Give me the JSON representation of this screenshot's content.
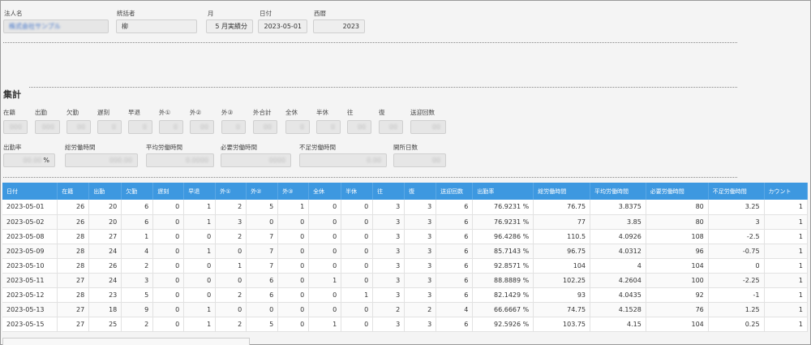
{
  "header": {
    "fields": [
      {
        "label": "法人名",
        "value": "株式会社サンプル",
        "blurred": true
      },
      {
        "label": "統括者",
        "value": "柳"
      },
      {
        "label": "月",
        "value": "5 月実績分"
      },
      {
        "label": "日付",
        "value": "2023-05-01"
      },
      {
        "label": "西暦",
        "value": "2023"
      }
    ]
  },
  "summary": {
    "title": "集計",
    "row1": [
      {
        "label": "在籍",
        "value": "000"
      },
      {
        "label": "出勤",
        "value": "000"
      },
      {
        "label": "欠勤",
        "value": "00"
      },
      {
        "label": "遅刻",
        "value": "0"
      },
      {
        "label": "早退",
        "value": "0"
      },
      {
        "label": "外①",
        "value": "0"
      },
      {
        "label": "外②",
        "value": "00"
      },
      {
        "label": "外③",
        "value": "0"
      },
      {
        "label": "外合計",
        "value": "00"
      },
      {
        "label": "全休",
        "value": "0"
      },
      {
        "label": "半休",
        "value": "0"
      },
      {
        "label": "往",
        "value": "00"
      },
      {
        "label": "復",
        "value": "00"
      },
      {
        "label": "送迎回数",
        "value": "00"
      }
    ],
    "row2": [
      {
        "label": "出勤率",
        "value": "00.00",
        "suffix": "%"
      },
      {
        "label": "総労働時間",
        "value": "000.00"
      },
      {
        "label": "平均労働時間",
        "value": "0.0000"
      },
      {
        "label": "必要労働時間",
        "value": "0000"
      },
      {
        "label": "不足労働時間",
        "value": "0.00"
      },
      {
        "label": "開所日数",
        "value": "00"
      }
    ]
  },
  "table": {
    "headers": [
      "日付",
      "在籍",
      "出勤",
      "欠勤",
      "遅刻",
      "早退",
      "外①",
      "外②",
      "外③",
      "全休",
      "半休",
      "往",
      "復",
      "送迎回数",
      "出勤率",
      "総労働時間",
      "平均労働時間",
      "必要労働時間",
      "不足労働時間",
      "カウント"
    ],
    "rows": [
      [
        "2023-05-01",
        "26",
        "20",
        "6",
        "0",
        "1",
        "2",
        "5",
        "1",
        "0",
        "0",
        "3",
        "3",
        "6",
        "76.9231 %",
        "76.75",
        "3.8375",
        "80",
        "3.25",
        "1"
      ],
      [
        "2023-05-02",
        "26",
        "20",
        "6",
        "0",
        "1",
        "3",
        "0",
        "0",
        "0",
        "0",
        "3",
        "3",
        "6",
        "76.9231 %",
        "77",
        "3.85",
        "80",
        "3",
        "1"
      ],
      [
        "2023-05-08",
        "28",
        "27",
        "1",
        "0",
        "0",
        "2",
        "7",
        "0",
        "0",
        "0",
        "3",
        "3",
        "6",
        "96.4286 %",
        "110.5",
        "4.0926",
        "108",
        "-2.5",
        "1"
      ],
      [
        "2023-05-09",
        "28",
        "24",
        "4",
        "0",
        "1",
        "0",
        "7",
        "0",
        "0",
        "0",
        "3",
        "3",
        "6",
        "85.7143 %",
        "96.75",
        "4.0312",
        "96",
        "-0.75",
        "1"
      ],
      [
        "2023-05-10",
        "28",
        "26",
        "2",
        "0",
        "0",
        "1",
        "7",
        "0",
        "0",
        "0",
        "3",
        "3",
        "6",
        "92.8571 %",
        "104",
        "4",
        "104",
        "0",
        "1"
      ],
      [
        "2023-05-11",
        "27",
        "24",
        "3",
        "0",
        "0",
        "0",
        "6",
        "0",
        "1",
        "0",
        "3",
        "3",
        "6",
        "88.8889 %",
        "102.25",
        "4.2604",
        "100",
        "-2.25",
        "1"
      ],
      [
        "2023-05-12",
        "28",
        "23",
        "5",
        "0",
        "0",
        "2",
        "6",
        "0",
        "0",
        "1",
        "3",
        "3",
        "6",
        "82.1429 %",
        "93",
        "4.0435",
        "92",
        "-1",
        "1"
      ],
      [
        "2023-05-13",
        "27",
        "18",
        "9",
        "0",
        "1",
        "0",
        "0",
        "0",
        "0",
        "0",
        "2",
        "2",
        "4",
        "66.6667 %",
        "74.75",
        "4.1528",
        "76",
        "1.25",
        "1"
      ],
      [
        "2023-05-15",
        "27",
        "25",
        "2",
        "0",
        "1",
        "2",
        "5",
        "0",
        "1",
        "0",
        "3",
        "3",
        "6",
        "92.5926 %",
        "103.75",
        "4.15",
        "104",
        "0.25",
        "1"
      ]
    ]
  }
}
